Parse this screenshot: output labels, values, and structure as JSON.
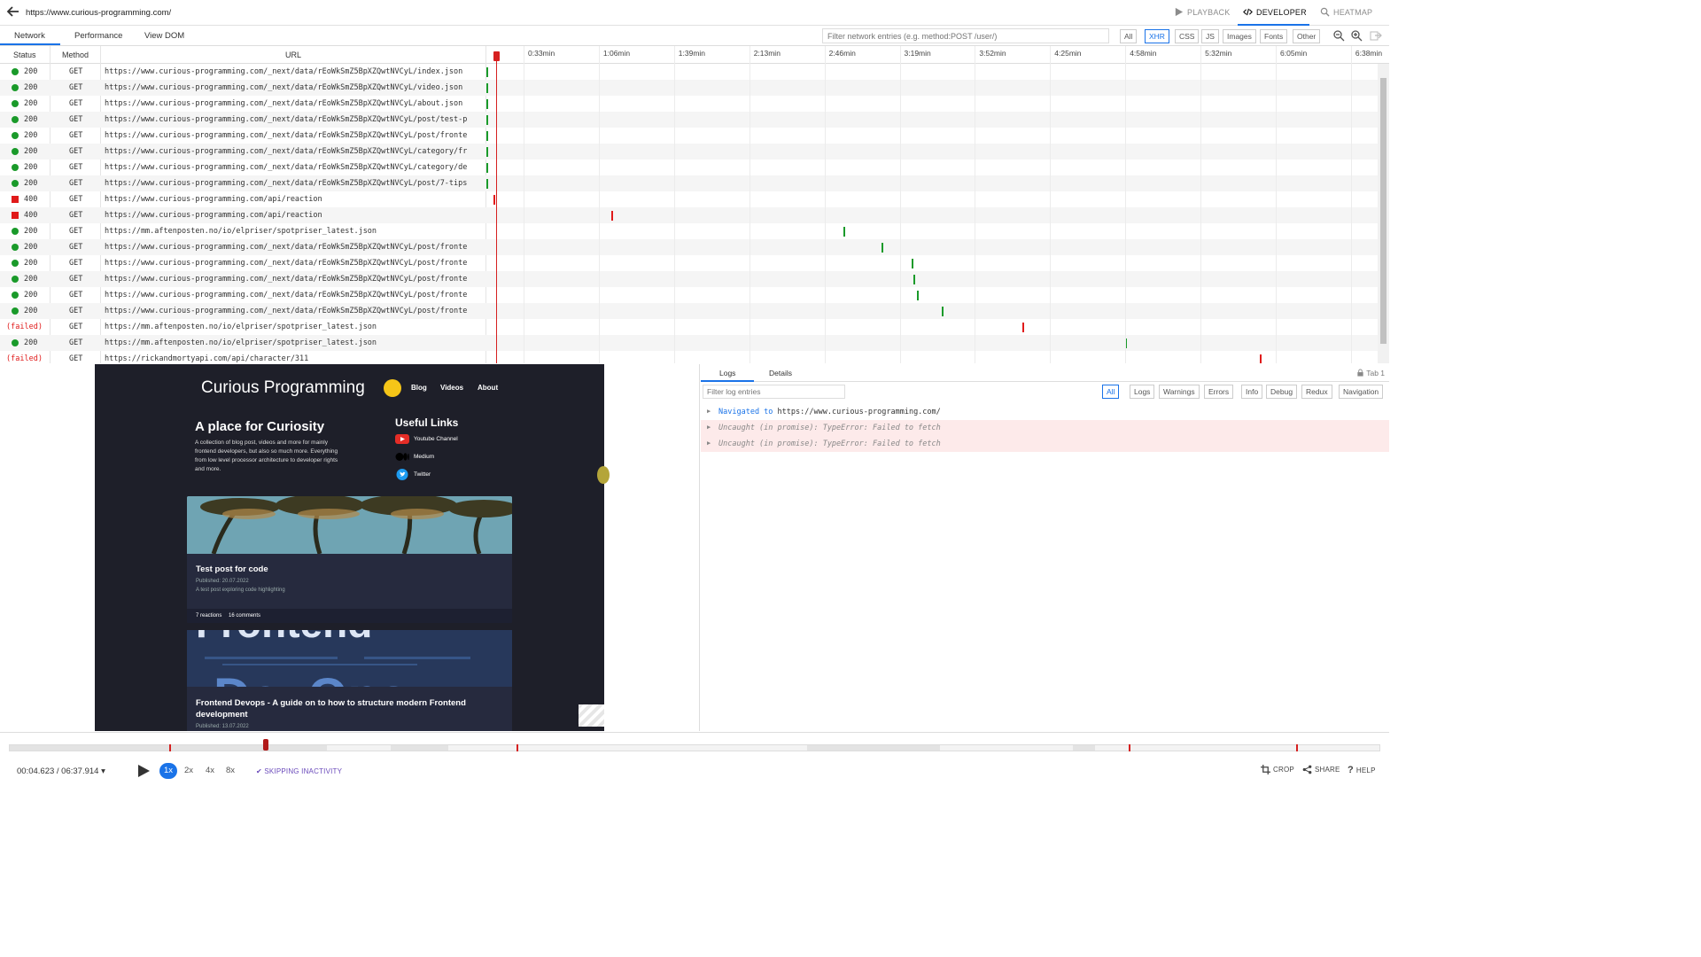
{
  "topbar": {
    "url": "https://www.curious-programming.com/",
    "modes": [
      {
        "label": "PLAYBACK",
        "icon": "play-icon"
      },
      {
        "label": "DEVELOPER",
        "icon": "code-icon"
      },
      {
        "label": "HEATMAP",
        "icon": "search-icon"
      }
    ]
  },
  "devtabs": [
    "Network",
    "Performance",
    "View DOM"
  ],
  "network_filter": {
    "placeholder": "Filter network entries (e.g. method:POST /user/)",
    "types": [
      "All",
      "XHR",
      "CSS",
      "JS",
      "Images",
      "Fonts",
      "Other"
    ],
    "active_type": "XHR"
  },
  "network": {
    "headers": {
      "status": "Status",
      "method": "Method",
      "url": "URL"
    },
    "ticks": [
      "0:33min",
      "1:06min",
      "1:39min",
      "2:13min",
      "2:46min",
      "3:19min",
      "3:52min",
      "4:25min",
      "4:58min",
      "5:32min",
      "6:05min",
      "6:38min"
    ],
    "rows": [
      {
        "status": "200",
        "method": "GET",
        "url": "https://www.curious-programming.com/_next/data/rEoWkSmZ5BpXZQwtNVCyL/index.json",
        "ok": true
      },
      {
        "status": "200",
        "method": "GET",
        "url": "https://www.curious-programming.com/_next/data/rEoWkSmZ5BpXZQwtNVCyL/video.json",
        "ok": true
      },
      {
        "status": "200",
        "method": "GET",
        "url": "https://www.curious-programming.com/_next/data/rEoWkSmZ5BpXZQwtNVCyL/about.json",
        "ok": true
      },
      {
        "status": "200",
        "method": "GET",
        "url": "https://www.curious-programming.com/_next/data/rEoWkSmZ5BpXZQwtNVCyL/post/test-p",
        "ok": true
      },
      {
        "status": "200",
        "method": "GET",
        "url": "https://www.curious-programming.com/_next/data/rEoWkSmZ5BpXZQwtNVCyL/post/fronte",
        "ok": true
      },
      {
        "status": "200",
        "method": "GET",
        "url": "https://www.curious-programming.com/_next/data/rEoWkSmZ5BpXZQwtNVCyL/category/fr",
        "ok": true
      },
      {
        "status": "200",
        "method": "GET",
        "url": "https://www.curious-programming.com/_next/data/rEoWkSmZ5BpXZQwtNVCyL/category/de",
        "ok": true
      },
      {
        "status": "200",
        "method": "GET",
        "url": "https://www.curious-programming.com/_next/data/rEoWkSmZ5BpXZQwtNVCyL/post/7-tips",
        "ok": true
      },
      {
        "status": "400",
        "method": "GET",
        "url": "https://www.curious-programming.com/api/reaction",
        "ok": false
      },
      {
        "status": "400",
        "method": "GET",
        "url": "https://www.curious-programming.com/api/reaction",
        "ok": false
      },
      {
        "status": "200",
        "method": "GET",
        "url": "https://mm.aftenposten.no/io/elpriser/spotpriser_latest.json",
        "ok": true
      },
      {
        "status": "200",
        "method": "GET",
        "url": "https://www.curious-programming.com/_next/data/rEoWkSmZ5BpXZQwtNVCyL/post/fronte",
        "ok": true
      },
      {
        "status": "200",
        "method": "GET",
        "url": "https://www.curious-programming.com/_next/data/rEoWkSmZ5BpXZQwtNVCyL/post/fronte",
        "ok": true
      },
      {
        "status": "200",
        "method": "GET",
        "url": "https://www.curious-programming.com/_next/data/rEoWkSmZ5BpXZQwtNVCyL/post/fronte",
        "ok": true
      },
      {
        "status": "200",
        "method": "GET",
        "url": "https://www.curious-programming.com/_next/data/rEoWkSmZ5BpXZQwtNVCyL/post/fronte",
        "ok": true
      },
      {
        "status": "200",
        "method": "GET",
        "url": "https://www.curious-programming.com/_next/data/rEoWkSmZ5BpXZQwtNVCyL/post/fronte",
        "ok": true
      },
      {
        "status": "(failed)",
        "method": "GET",
        "url": "https://mm.aftenposten.no/io/elpriser/spotpriser_latest.json",
        "ok": false
      },
      {
        "status": "200",
        "method": "GET",
        "url": "https://mm.aftenposten.no/io/elpriser/spotpriser_latest.json",
        "ok": true
      },
      {
        "status": "(failed)",
        "method": "GET",
        "url": "https://rickandmortyapi.com/api/character/311",
        "ok": false
      }
    ]
  },
  "site": {
    "title": "Curious Programming",
    "nav": [
      "Blog",
      "Videos",
      "About"
    ],
    "hero_title": "A place for Curiosity",
    "hero_text": "A collection of blog post, videos and more for mainly frontend developers, but also so much more. Everything from low level processor architecture to developer rights and more.",
    "links_title": "Useful Links",
    "links": [
      "Youtube Channel",
      "Medium",
      "Twitter"
    ],
    "card1": {
      "title": "Test post for code",
      "date": "Published: 20.07.2022",
      "desc": "A test post exploring code highlighting",
      "reactions": "7 reactions",
      "comments": "16 comments"
    },
    "card2": {
      "title": "Frontend Devops - A guide on to how to structure modern Frontend development",
      "date": "Published: 13.07.2022"
    }
  },
  "logs": {
    "tabs": [
      "Logs",
      "Details"
    ],
    "tab_indicator": "Tab 1",
    "filter_placeholder": "Filter log entries",
    "levels": [
      "All",
      "Logs",
      "Warnings",
      "Errors",
      "Info",
      "Debug",
      "Redux",
      "Navigation"
    ],
    "active_level": "All",
    "entries": [
      {
        "prefix": "Navigated to",
        "text": "https://www.curious-programming.com/",
        "type": "nav"
      },
      {
        "prefix": "",
        "text": "Uncaught (in promise): TypeError: Failed to fetch",
        "type": "error"
      },
      {
        "prefix": "",
        "text": "Uncaught (in promise): TypeError: Failed to fetch",
        "type": "error"
      }
    ]
  },
  "player": {
    "time": "00:04.623 / 06:37.914",
    "speeds": [
      "1x",
      "2x",
      "4x",
      "8x"
    ],
    "active_speed": "1x",
    "skip_label": "SKIPPING INACTIVITY",
    "actions": [
      {
        "label": "CROP",
        "icon": "crop-icon"
      },
      {
        "label": "SHARE",
        "icon": "share-icon"
      },
      {
        "label": "HELP",
        "icon": "help-icon"
      }
    ]
  },
  "colors": {
    "accent": "#1a73e8",
    "ok": "#1a9a2a",
    "error": "#e01a1a",
    "site_bg": "#1e1f29"
  }
}
